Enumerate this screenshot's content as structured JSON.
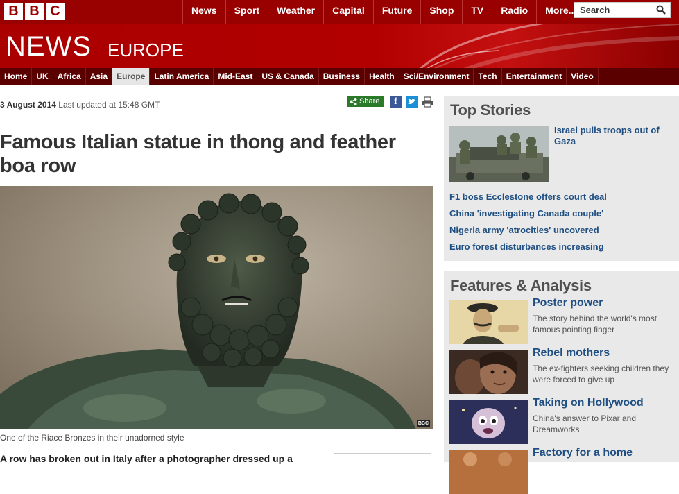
{
  "brand": {
    "letters": [
      "B",
      "B",
      "C"
    ]
  },
  "topnav": [
    "News",
    "Sport",
    "Weather",
    "Capital",
    "Future",
    "Shop",
    "TV",
    "Radio",
    "More..."
  ],
  "search": {
    "value": "Search"
  },
  "masthead": {
    "news": "NEWS",
    "section": "EUROPE"
  },
  "secnav": [
    "Home",
    "UK",
    "Africa",
    "Asia",
    "Europe",
    "Latin America",
    "Mid-East",
    "US & Canada",
    "Business",
    "Health",
    "Sci/Environment",
    "Tech",
    "Entertainment",
    "Video"
  ],
  "secnav_active": "Europe",
  "article": {
    "date": "3 August 2014",
    "updated": "Last updated at 15:48 GMT",
    "share": "Share",
    "headline": "Famous Italian statue in thong and feather boa row",
    "image_tag": "BBC",
    "caption": "One of the Riace Bronzes in their unadorned style",
    "lead": "A row has broken out in Italy after a photographer dressed up a"
  },
  "top_stories": {
    "heading": "Top Stories",
    "main": "Israel pulls troops out of Gaza",
    "items": [
      "F1 boss Ecclestone offers court deal",
      "China 'investigating Canada couple'",
      "Nigeria army 'atrocities' uncovered",
      "Euro forest disturbances increasing"
    ]
  },
  "features": {
    "heading": "Features & Analysis",
    "items": [
      {
        "title": "Poster power",
        "desc": "The story behind the world's most famous pointing finger"
      },
      {
        "title": "Rebel mothers",
        "desc": "The ex-fighters seeking children they were forced to give up"
      },
      {
        "title": "Taking on Hollywood",
        "desc": "China's answer to Pixar and Dreamworks"
      },
      {
        "title": "Factory for a home",
        "desc": ""
      }
    ]
  },
  "colors": {
    "bbc_red": "#990000",
    "link_blue": "#1f4f82",
    "share_green": "#2a7a2a"
  }
}
